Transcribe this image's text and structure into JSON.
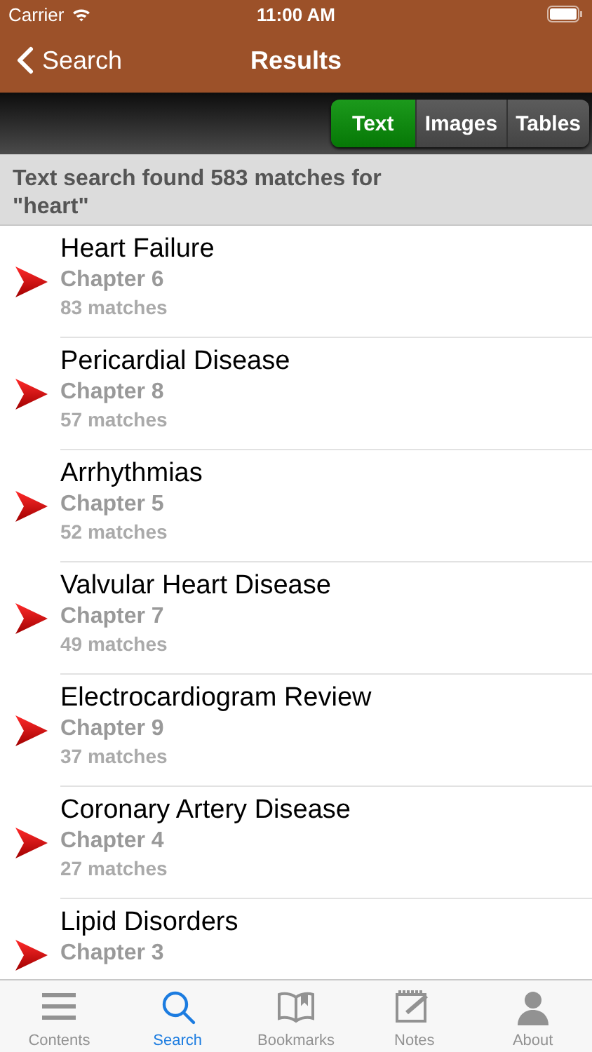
{
  "status_bar": {
    "carrier": "Carrier",
    "time": "11:00 AM"
  },
  "nav": {
    "back": "Search",
    "title": "Results"
  },
  "segments": [
    {
      "label": "Text",
      "selected": true
    },
    {
      "label": "Images",
      "selected": false
    },
    {
      "label": "Tables",
      "selected": false
    }
  ],
  "summary": "Text search found 583 matches for \"heart\"",
  "results": [
    {
      "title": "Heart Failure",
      "chapter": "Chapter 6",
      "matches": "83 matches"
    },
    {
      "title": "Pericardial Disease",
      "chapter": "Chapter 8",
      "matches": "57 matches"
    },
    {
      "title": "Arrhythmias",
      "chapter": "Chapter 5",
      "matches": "52 matches"
    },
    {
      "title": "Valvular Heart Disease",
      "chapter": "Chapter 7",
      "matches": "49 matches"
    },
    {
      "title": "Electrocardiogram Review",
      "chapter": "Chapter 9",
      "matches": "37 matches"
    },
    {
      "title": "Coronary Artery Disease",
      "chapter": "Chapter 4",
      "matches": "27 matches"
    },
    {
      "title": "Lipid Disorders",
      "chapter": "Chapter 3"
    }
  ],
  "tab_bar": [
    {
      "kind": "contents",
      "label": "Contents",
      "selected": false
    },
    {
      "kind": "search",
      "label": "Search",
      "selected": true
    },
    {
      "kind": "bookmarks",
      "label": "Bookmarks",
      "selected": false
    },
    {
      "kind": "notes",
      "label": "Notes",
      "selected": false
    },
    {
      "kind": "about",
      "label": "About",
      "selected": false
    }
  ]
}
